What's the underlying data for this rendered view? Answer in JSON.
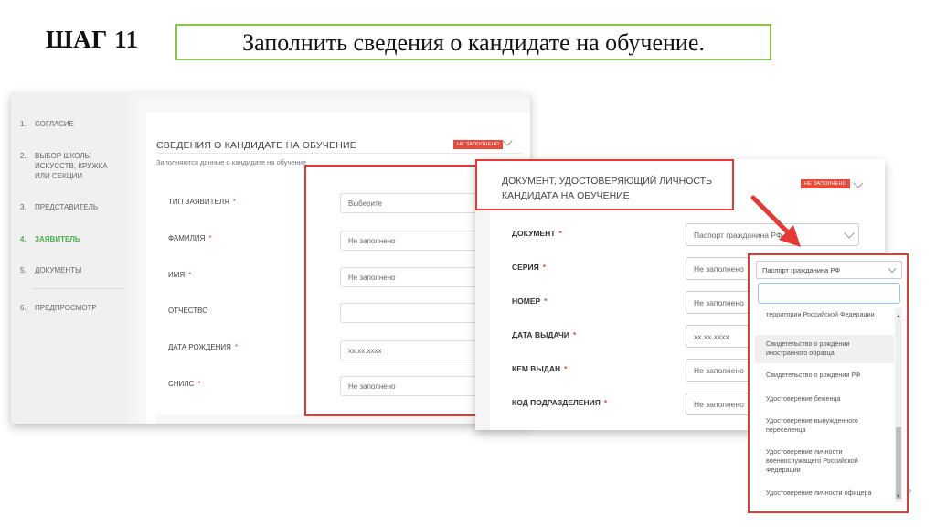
{
  "header": {
    "step": "ШАГ 11",
    "instruction": "Заполнить сведения о кандидате на обучение."
  },
  "sidebar": {
    "items": [
      {
        "num": "1.",
        "label": "СОГЛАСИЕ"
      },
      {
        "num": "2.",
        "label": "ВЫБОР ШКОЛЫ ИСКУССТВ, КРУЖКА ИЛИ СЕКЦИИ"
      },
      {
        "num": "3.",
        "label": "ПРЕДСТАВИТЕЛЬ"
      },
      {
        "num": "4.",
        "label": "ЗАЯВИТЕЛЬ"
      },
      {
        "num": "5.",
        "label": "ДОКУМЕНТЫ"
      },
      {
        "num": "6.",
        "label": "ПРЕДПРОСМОТР"
      }
    ]
  },
  "candidate_card": {
    "title": "СВЕДЕНИЯ О КАНДИДАТЕ НА ОБУЧЕНИЕ",
    "badge": "НЕ ЗАПОЛНЕНО",
    "subtitle": "Заполняются данные о кандидате на обучение",
    "required_mark": "*",
    "fields": [
      {
        "label": "ТИП ЗАЯВИТЕЛЯ",
        "value": "Выберите",
        "required": "*"
      },
      {
        "label": "ФАМИЛИЯ",
        "value": "Не заполнено",
        "required": "*"
      },
      {
        "label": "ИМЯ",
        "value": "Не заполнено",
        "required": "*"
      },
      {
        "label": "ОТЧЕСТВО",
        "value": "",
        "required": ""
      },
      {
        "label": "ДАТА РОЖДЕНИЯ",
        "value": "хх.хх.хххх",
        "required": "*"
      },
      {
        "label": "СНИЛС",
        "value": "Не заполнено",
        "required": "*"
      }
    ]
  },
  "document_card": {
    "title_line1": "ДОКУМЕНТ, УДОСТОВЕРЯЮЩИЙ ЛИЧНОСТЬ",
    "title_line2": "КАНДИДАТА НА ОБУЧЕНИЕ",
    "badge": "НЕ ЗАПОЛНЕНО",
    "fields": [
      {
        "label": "ДОКУМЕНТ",
        "value": "Паспорт гражданина РФ",
        "required": "*"
      },
      {
        "label": "СЕРИЯ",
        "value": "Не заполнено",
        "required": "*"
      },
      {
        "label": "НОМЕР",
        "value": "Не заполнено",
        "required": "*"
      },
      {
        "label": "ДАТА ВЫДАЧИ",
        "value": "хх.хх.хххх",
        "required": "*"
      },
      {
        "label": "КЕМ ВЫДАН",
        "value": "Не заполнено",
        "required": "*"
      },
      {
        "label": "КОД ПОДРАЗДЕЛЕНИЯ",
        "value": "Не заполнено",
        "required": "*"
      }
    ]
  },
  "dropdown": {
    "selected": "Паспорт гражданина РФ",
    "search_value": "",
    "options": [
      "территории Российской Федерации",
      "Свидетельство о рождении иностранного образца",
      "Свидетельство о рождении РФ",
      "Удостоверение беженца",
      "Удостоверение вынужденного переселенца",
      "Удостоверение личности военнослужащего Российской Федерации",
      "Удостоверение личности офицера"
    ],
    "scroll_up": "▲",
    "scroll_down": "▼"
  },
  "colors": {
    "accent_green": "#4caf50",
    "badge_red": "#e74c3c",
    "highlight_red": "#e53935",
    "step_box_green": "#8bc34a"
  }
}
